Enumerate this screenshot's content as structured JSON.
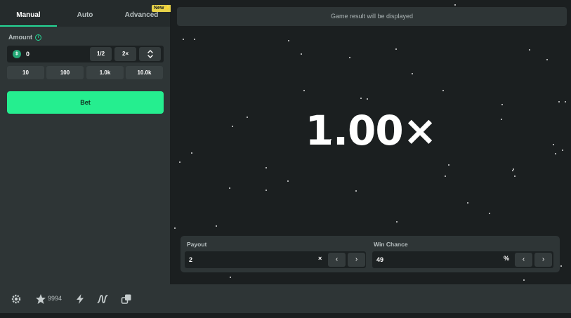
{
  "tabs": [
    {
      "label": "Manual",
      "active": true
    },
    {
      "label": "Auto",
      "active": false
    },
    {
      "label": "Advanced",
      "active": false
    }
  ],
  "new_badge": "New✨",
  "amount": {
    "label": "Amount",
    "value": "0",
    "coin_icon": "coin-icon",
    "half_label": "1/2",
    "double_label": "2×",
    "updown_icon": "chevron-up-down-icon"
  },
  "chips": [
    "10",
    "100",
    "1.0k",
    "10.0k"
  ],
  "bet_label": "Bet",
  "game": {
    "result_text": "Game result will be displayed",
    "multiplier": "1.00×"
  },
  "payout": {
    "label": "Payout",
    "value": "2",
    "unit": "×"
  },
  "win_chance": {
    "label": "Win Chance",
    "value": "49",
    "unit": "%"
  },
  "bottom": {
    "favorites_count": "9994",
    "icons": [
      "settings-icon",
      "star-icon",
      "lightning-icon",
      "graph-icon",
      "fairness-icon"
    ]
  },
  "colors": {
    "accent": "#25ee8f",
    "panel": "#2e3536",
    "background": "#1b1f20"
  }
}
